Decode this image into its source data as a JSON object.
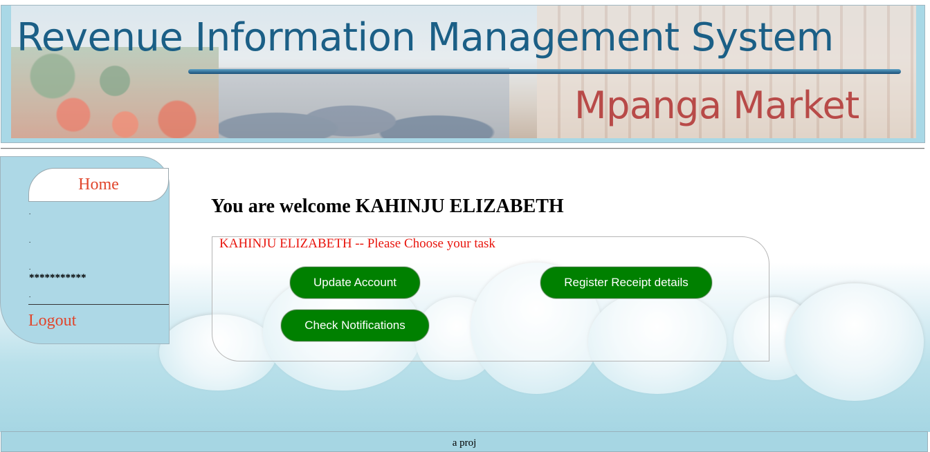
{
  "banner": {
    "title": "Revenue Information Management System",
    "subtitle": "Mpanga Market"
  },
  "sidebar": {
    "home_label": "Home",
    "dots": [
      ".",
      ".",
      "."
    ],
    "password_mask": "***********",
    "dot_after": ".",
    "logout_label": "Logout"
  },
  "main": {
    "welcome": "You are welcome KAHINJU ELIZABETH",
    "task_legend": "KAHINJU ELIZABETH -- Please Choose your task",
    "buttons": {
      "update_account": "Update Account",
      "register_receipt": "Register Receipt details",
      "check_notifications": "Check Notifications"
    }
  },
  "footer": {
    "text": "a proj"
  },
  "colors": {
    "sidebar_bg": "#add8e6",
    "link_red": "#e0452b",
    "legend_red": "#e8140c",
    "button_green": "#008000"
  }
}
